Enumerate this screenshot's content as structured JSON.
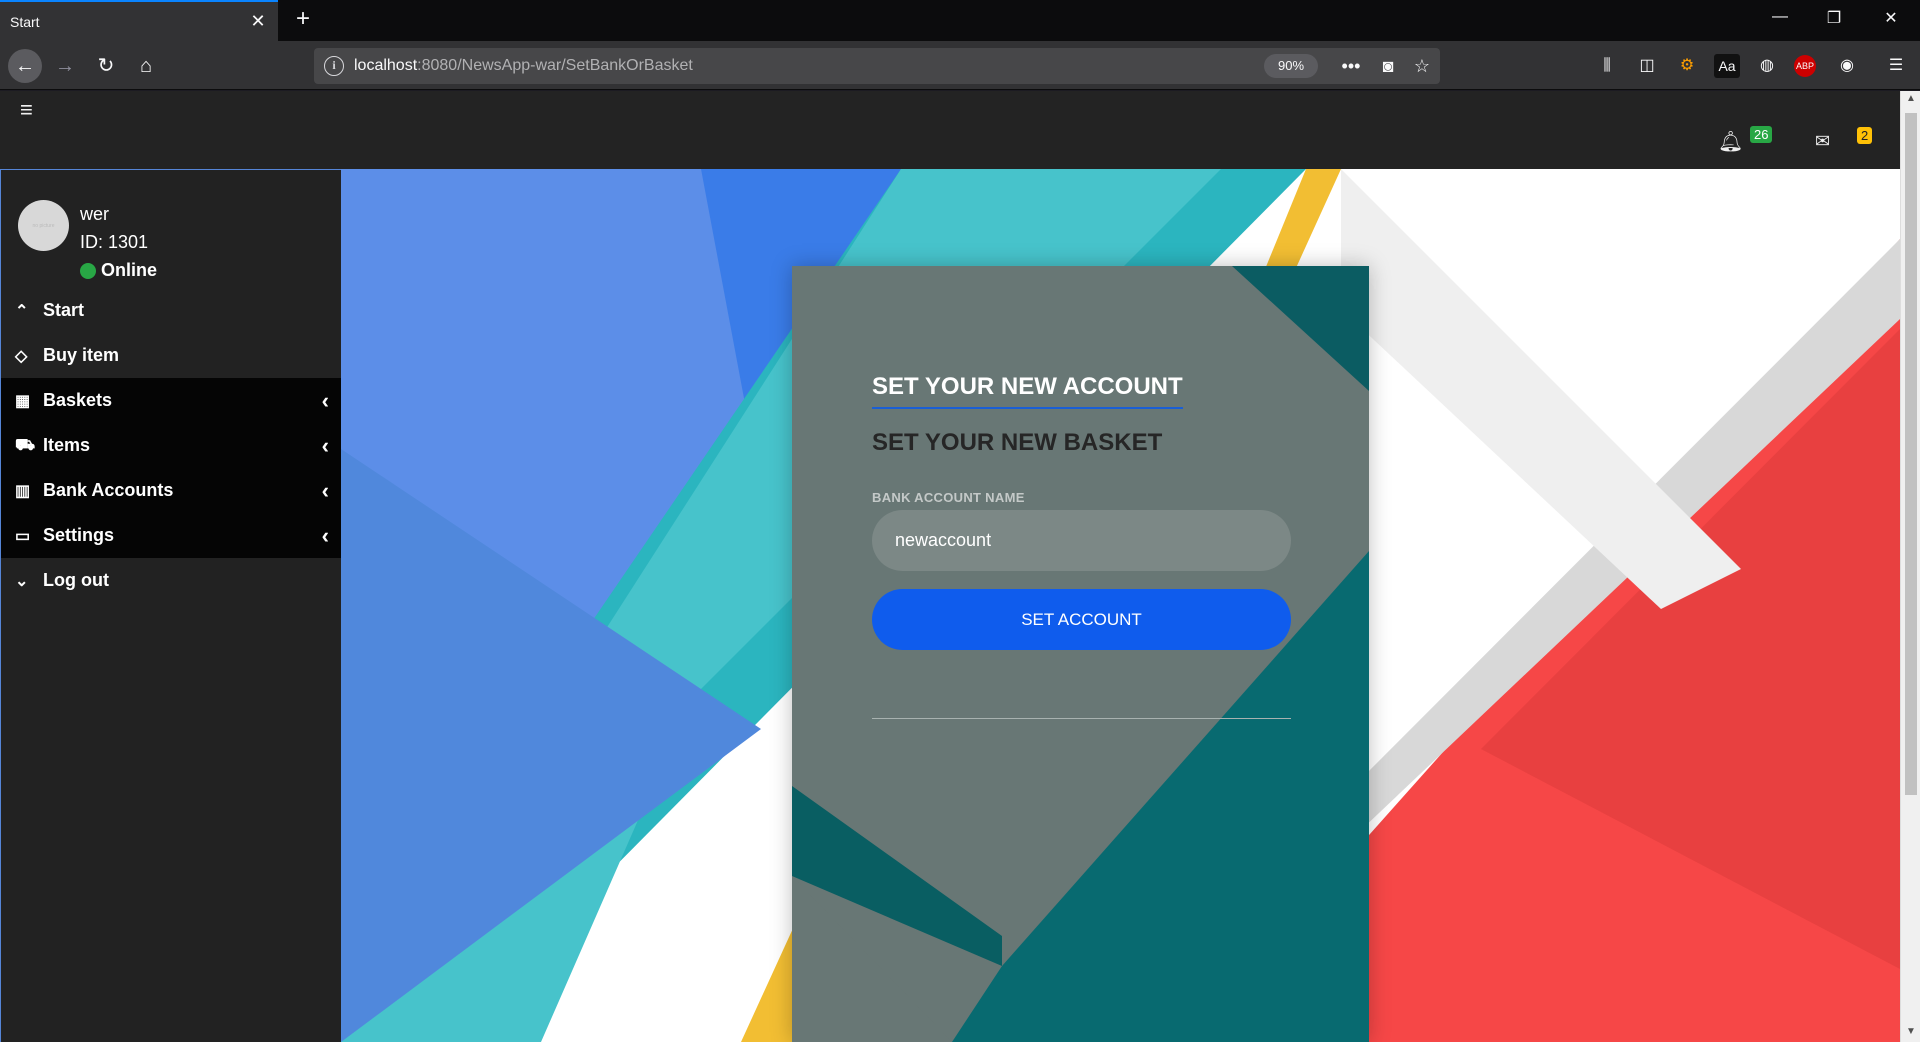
{
  "browser": {
    "tab_title": "Start",
    "tab_close": "✕",
    "new_tab": "+",
    "url_host": "localhost",
    "url_rest": ":8080/NewsApp-war/SetBankOrBasket",
    "zoom": "90%"
  },
  "topbar": {
    "notifications_count": "26",
    "messages_count": "2"
  },
  "user": {
    "name": "wer",
    "id_label": "ID: 1301",
    "status": "Online",
    "avatar_text": "no picture"
  },
  "menu": [
    {
      "label": "Start",
      "icon": "chevron-up-icon"
    },
    {
      "label": "Buy item",
      "icon": "diamond-icon"
    },
    {
      "label": "Baskets",
      "icon": "grid-icon"
    },
    {
      "label": "Items",
      "icon": "cart-icon"
    },
    {
      "label": "Bank Accounts",
      "icon": "bar-chart-icon"
    },
    {
      "label": "Settings",
      "icon": "laptop-icon"
    },
    {
      "label": "Log out",
      "icon": "chevron-down-icon"
    }
  ],
  "form": {
    "title": "SET YOUR NEW ACCOUNT",
    "subtitle": "SET YOUR NEW BASKET",
    "field_label": "BANK ACCOUNT NAME",
    "field_value": "newaccount",
    "submit_label": "SET ACCOUNT"
  },
  "colors": {
    "accent": "#0f5ced",
    "online": "#28a745",
    "badge_notifications": "#28a745",
    "badge_messages": "#ffc107"
  }
}
